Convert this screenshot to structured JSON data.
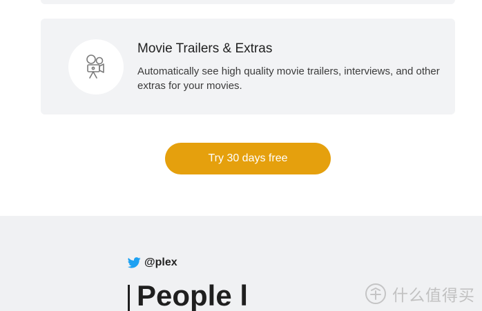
{
  "feature": {
    "icon": "movie-camera-icon",
    "title": "Movie Trailers & Extras",
    "description": "Automatically see high quality movie trailers, interviews, and other extras for your movies."
  },
  "cta": {
    "label": "Try 30 days free",
    "color": "#e5a00d"
  },
  "social": {
    "icon": "twitter-bird-icon",
    "handle": "@plex",
    "headline": "People l",
    "twitter_color": "#1da1f2"
  },
  "watermark": {
    "icon": "zhihu-mark-icon",
    "text": "什么值得买"
  },
  "colors": {
    "card_background": "#f2f3f5",
    "footer_background": "#f0f1f3"
  }
}
